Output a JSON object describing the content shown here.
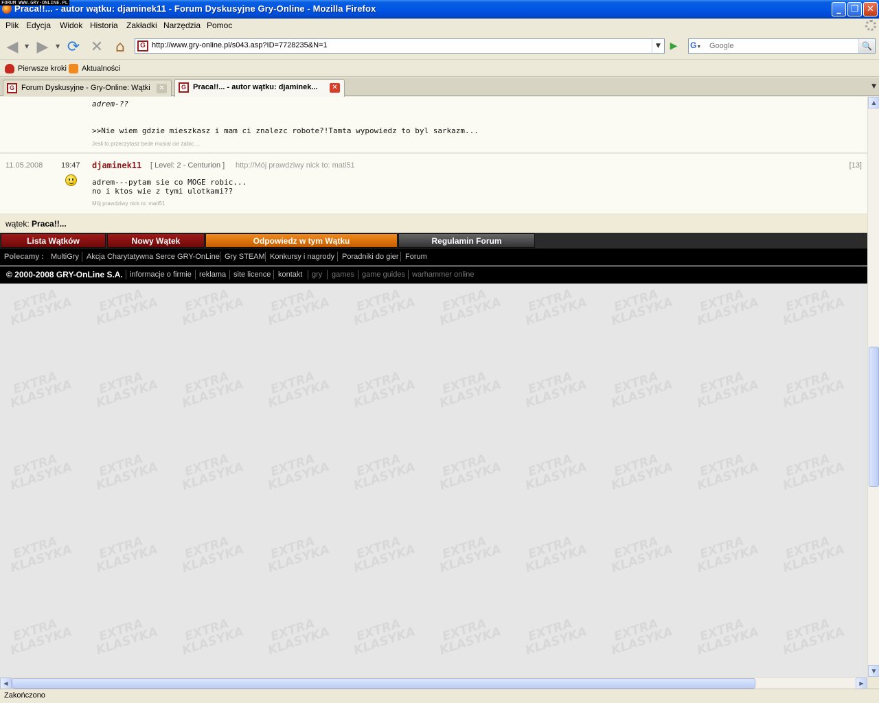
{
  "window": {
    "watermark": "FORUM WWW.GRY-ONLINE.PL",
    "title": "Praca!!... - autor wątku: djaminek11 - Forum Dyskusyjne Gry-Online - Mozilla Firefox",
    "minimize": "_",
    "maximize": "❐",
    "close": "✕"
  },
  "menu": [
    "Plik",
    "Edycja",
    "Widok",
    "Historia",
    "Zakładki",
    "Narzędzia",
    "Pomoc"
  ],
  "nav": {
    "back": "◀",
    "forward": "▶",
    "reload": "⟳",
    "stop": "✕",
    "home": "⌂",
    "url": "http://www.gry-online.pl/s043.asp?ID=7728235&N=1",
    "go": "▶",
    "search_engine": "G",
    "search_placeholder": "Google",
    "search_button": "🔍"
  },
  "bookmarks": [
    "Pierwsze kroki",
    "Aktualności"
  ],
  "tabs": [
    {
      "label": "Forum Dyskusyjne - Gry-Online: Wątki",
      "active": false
    },
    {
      "label": "Praca!!... - autor wątku: djaminek...",
      "active": true
    }
  ],
  "favicon_letter": "G",
  "posts": [
    {
      "line1": "adrem-??",
      "line2": ">>Nie wiem gdzie mieszkasz i mam ci znalezc robote?!Tamta wypowiedz to byl sarkazm...",
      "signature": "Jesli to przeczytasz bede musial cie zabic...."
    },
    {
      "date": "11.05.2008",
      "time": "19:47",
      "author": "djaminek11",
      "level": "[ Level: 2 - Centurion ]",
      "nick": "http://Mój prawdziwy nick to: mati51",
      "number": "[13]",
      "line1": "adrem---pytam sie co MOGE robic...",
      "line2": "no i ktos wie z tymi ulotkami??",
      "signature": "Mój prawdziwy nick to: mati51"
    }
  ],
  "thread": {
    "label": "wątek:",
    "title": "Praca!!..."
  },
  "actions": [
    "Lista Wątków",
    "Nowy Wątek",
    "Odpowiedz w tym Wątku",
    "Regulamin Forum"
  ],
  "polecamy": {
    "label": "Polecamy :",
    "links": [
      "MultiGry",
      "Akcja Charytatywna Serce GRY-OnLine",
      "Gry STEAM",
      "Konkursy i nagrody",
      "Poradniki do gier",
      "Forum"
    ]
  },
  "footer": {
    "copyright": "© 2000-2008 GRY-OnLine S.A.",
    "links": [
      "informacje o firmie",
      "reklama",
      "site licence",
      "kontakt"
    ],
    "dim_links": [
      "gry",
      "games",
      "game guides",
      "warhammer online"
    ]
  },
  "status": "Zakończono",
  "colors": {
    "accent_red": "#8b1a1a",
    "accent_orange": "#e07410",
    "titlebar": "#0055e5"
  }
}
